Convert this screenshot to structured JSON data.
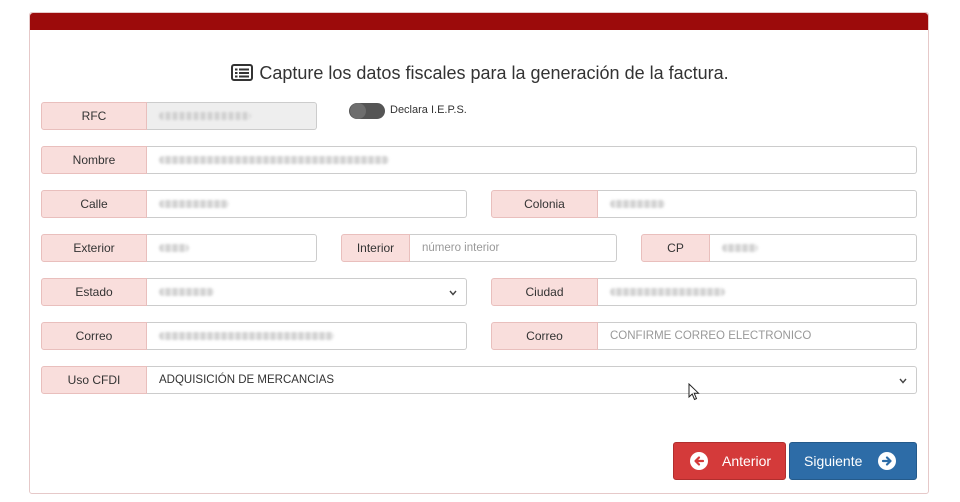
{
  "form": {
    "title": "Capture los datos fiscales para la generación de la factura.",
    "title_icon": "list-alt-icon",
    "ieps_label": "Declara I.E.P.S.",
    "fields": {
      "rfc": {
        "label": "RFC"
      },
      "nombre": {
        "label": "Nombre"
      },
      "calle": {
        "label": "Calle"
      },
      "colonia": {
        "label": "Colonia"
      },
      "exterior": {
        "label": "Exterior"
      },
      "interior": {
        "label": "Interior",
        "placeholder": "número interior"
      },
      "cp": {
        "label": "CP"
      },
      "estado": {
        "label": "Estado"
      },
      "ciudad": {
        "label": "Ciudad"
      },
      "correo": {
        "label": "Correo"
      },
      "correo_confirm": {
        "label": "Correo",
        "placeholder": "CONFIRME CORREO ELECTRÓNICO"
      },
      "uso_cfdi": {
        "label": "Uso CFDI",
        "value": "ADQUISICIÓN DE MERCANCIAS"
      }
    },
    "buttons": {
      "prev": "Anterior",
      "next": "Siguiente"
    }
  },
  "colors": {
    "header_bar": "#9c0b0b",
    "label_bg": "#f9dedc",
    "prev_button": "#d43a3a",
    "next_button": "#2d6ca7"
  }
}
